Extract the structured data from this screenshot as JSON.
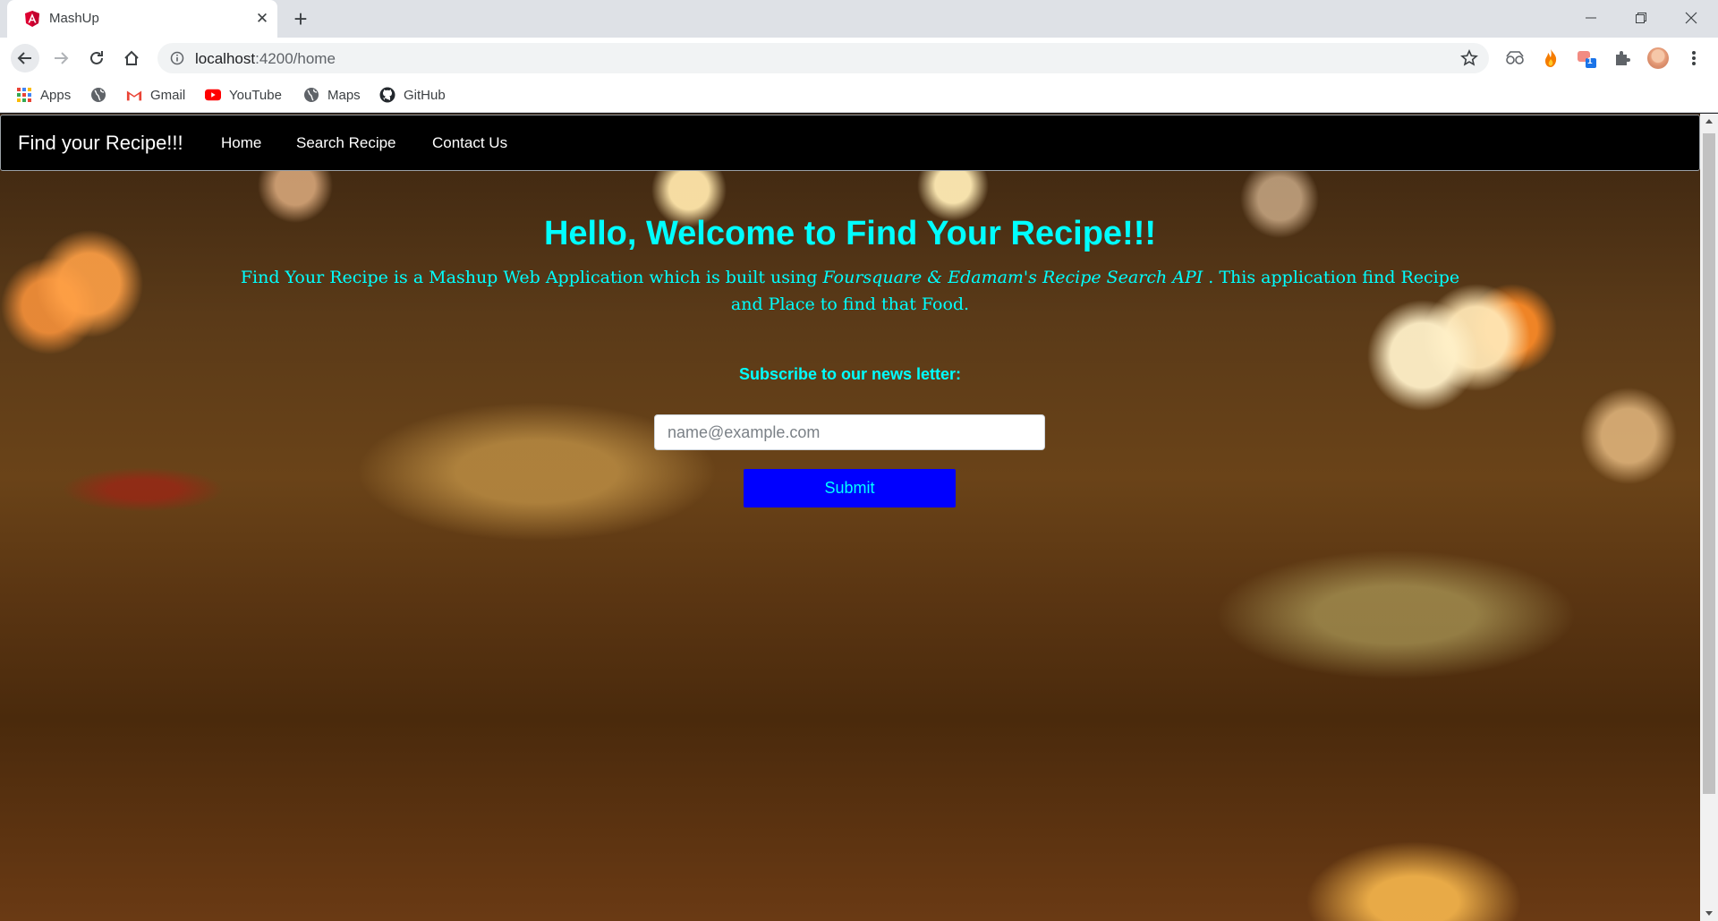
{
  "browser": {
    "tab_title": "MashUp",
    "url_host": "localhost",
    "url_rest": ":4200/home",
    "bookmarks": [
      {
        "label": "Apps",
        "icon": "apps-grid-icon"
      },
      {
        "label": "",
        "icon": "globe-icon"
      },
      {
        "label": "Gmail",
        "icon": "gmail-icon"
      },
      {
        "label": "YouTube",
        "icon": "youtube-icon"
      },
      {
        "label": "Maps",
        "icon": "globe-icon"
      },
      {
        "label": "GitHub",
        "icon": "github-icon"
      }
    ],
    "extension_badge": "1"
  },
  "navbar": {
    "brand": "Find your Recipe!!!",
    "links": [
      "Home",
      "Search Recipe",
      "Contact Us"
    ]
  },
  "hero": {
    "heading_plain": "Hello, Welcome to ",
    "heading_bold": "Find Your Recipe!!!",
    "desc_before": "Find Your Recipe is a Mashup Web Application which is built using ",
    "desc_italic": "Foursquare & Edamam's Recipe Search API",
    "desc_after": " . This application find Recipe and Place to find that Food."
  },
  "newsletter": {
    "label": "Subscribe to our news letter:",
    "placeholder": "name@example.com",
    "value": "",
    "submit_label": "Submit"
  },
  "colors": {
    "accent_text": "#00ffff",
    "submit_bg": "#0000ff",
    "navbar_bg": "#000000"
  }
}
